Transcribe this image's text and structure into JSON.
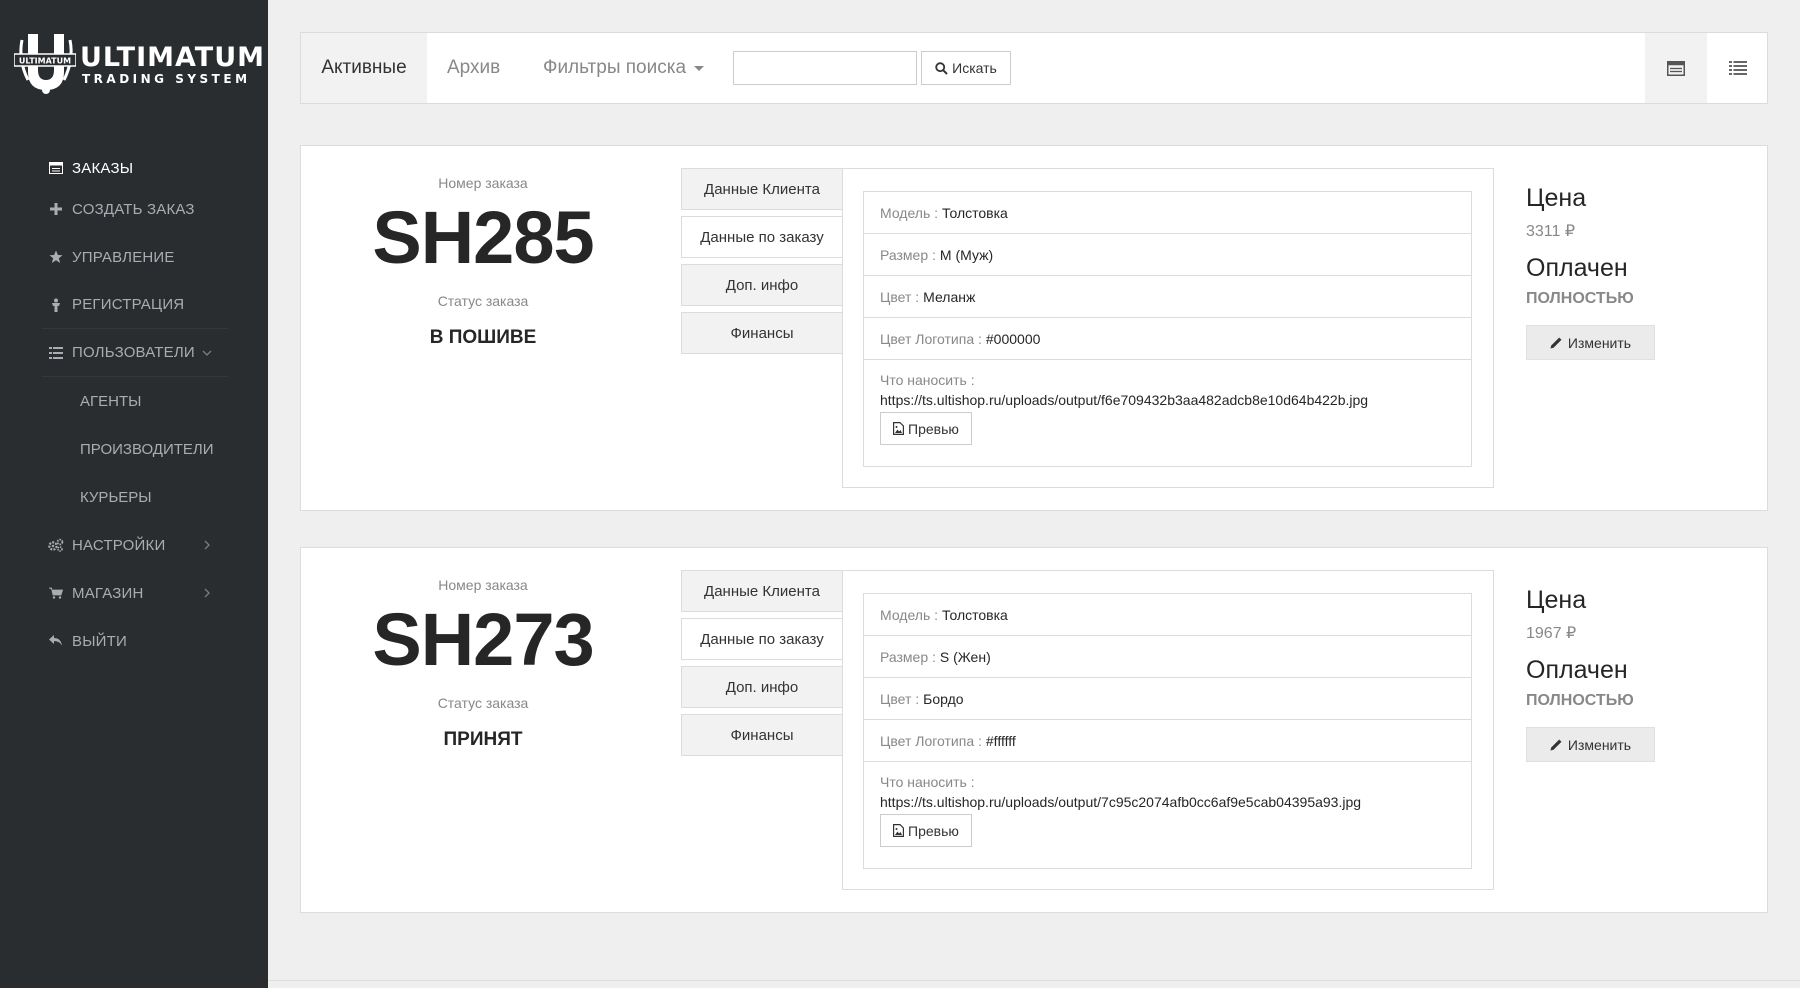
{
  "brand": {
    "title": "ULTIMATUM",
    "subtitle": "TRADING SYSTEM",
    "mark_text": "ULTIMATUM"
  },
  "sidebar": {
    "items": [
      {
        "label": "Заказы",
        "icon": "orders-icon"
      },
      {
        "label": "Создать заказ",
        "icon": "plus-icon"
      },
      {
        "label": "Управление",
        "icon": "star-icon"
      },
      {
        "label": "Регистрация",
        "icon": "person-icon"
      },
      {
        "label": "Пользователи",
        "icon": "list-icon"
      },
      {
        "label": "Агенты"
      },
      {
        "label": "Производители"
      },
      {
        "label": "Курьеры"
      },
      {
        "label": "Настройки",
        "icon": "cogs-icon"
      },
      {
        "label": "Магазин",
        "icon": "cart-icon"
      },
      {
        "label": "Выйти",
        "icon": "reply-icon"
      }
    ]
  },
  "toolbar": {
    "tab_active": "Активные",
    "tab_archive": "Архив",
    "tab_filters": "Фильтры поиска",
    "search_placeholder": "",
    "search_button": "Искать"
  },
  "orders": [
    {
      "number_label": "Номер заказа",
      "number": "SH285",
      "status_label": "Статус заказа",
      "status": "В ПОШИВЕ",
      "tabs": [
        "Данные Клиента",
        "Данные по заказу",
        "Доп. инфо",
        "Финансы"
      ],
      "fields": {
        "model_label": "Модель :",
        "model": "Толстовка",
        "size_label": "Размер :",
        "size": "M (Муж)",
        "color_label": "Цвет :",
        "color": "Меланж",
        "logo_color_label": "Цвет Логотипа :",
        "logo_color": "#000000",
        "print_label": "Что наносить :",
        "print_url": "https://ts.ultishop.ru/uploads/output/f6e709432b3aa482adcb8e10d64b422b.jpg",
        "preview_button": "Превью"
      },
      "price_label": "Цена",
      "price": "3311 ₽",
      "paid_label": "Оплачен",
      "paid_status": "полностью",
      "edit_button": "Изменить"
    },
    {
      "number_label": "Номер заказа",
      "number": "SH273",
      "status_label": "Статус заказа",
      "status": "ПРИНЯТ",
      "tabs": [
        "Данные Клиента",
        "Данные по заказу",
        "Доп. инфо",
        "Финансы"
      ],
      "fields": {
        "model_label": "Модель :",
        "model": "Толстовка",
        "size_label": "Размер :",
        "size": "S (Жен)",
        "color_label": "Цвет :",
        "color": "Бордо",
        "logo_color_label": "Цвет Логотипа :",
        "logo_color": "#ffffff",
        "print_label": "Что наносить :",
        "print_url": "https://ts.ultishop.ru/uploads/output/7c95c2074afb0cc6af9e5cab04395a93.jpg",
        "preview_button": "Превью"
      },
      "price_label": "Цена",
      "price": "1967 ₽",
      "paid_label": "Оплачен",
      "paid_status": "полностью",
      "edit_button": "Изменить"
    }
  ]
}
